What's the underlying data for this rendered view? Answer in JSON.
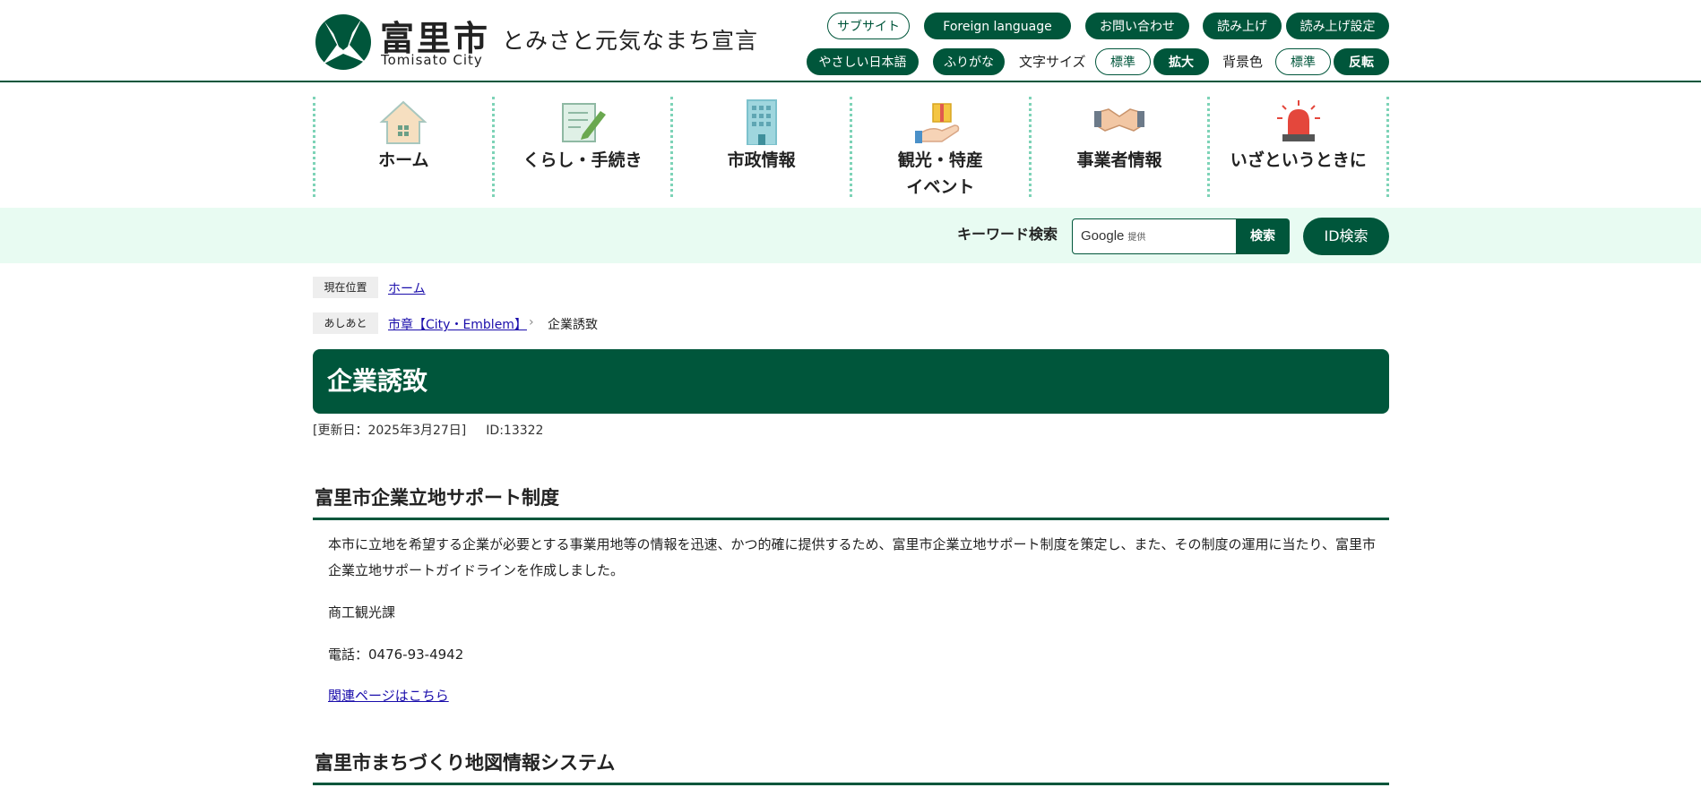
{
  "header": {
    "logo_jp": "富里市",
    "logo_en": "Tomisato City",
    "slogan": "とみさと元気なまち宣言",
    "sub_site": "サブサイト",
    "foreign_language": "Foreign language",
    "contact": "お問い合わせ",
    "read_aloud": "読み上げ",
    "read_aloud_settings": "読み上げ設定",
    "easy_japanese": "やさしい日本語",
    "furigana": "ふりがな",
    "font_size_label": "文字サイズ",
    "font_size_standard": "標準",
    "font_size_large": "拡大",
    "bg_color_label": "背景色",
    "bg_standard": "標準",
    "bg_invert": "反転"
  },
  "nav": {
    "items": [
      {
        "label": "ホーム",
        "icon": "house-icon"
      },
      {
        "label": "くらし・手続き",
        "icon": "document-pencil-icon"
      },
      {
        "label": "市政情報",
        "icon": "building-icon"
      },
      {
        "label": "観光・特産\nイベント",
        "icon": "gift-hand-icon"
      },
      {
        "label": "事業者情報",
        "icon": "handshake-icon"
      },
      {
        "label": "いざというときに",
        "icon": "alarm-light-icon"
      }
    ]
  },
  "search": {
    "keyword_label": "キーワード検索",
    "google_label": "Google",
    "google_provided": "提供",
    "search_button": "検索",
    "id_search_button": "ID検索"
  },
  "breadcrumbs": {
    "current_label": "現在位置",
    "home_link": "ホーム",
    "trail_label": "あしあと",
    "trail_link": "市章【City・Emblem】",
    "trail_sep": "›",
    "trail_current": "企業誘致"
  },
  "page": {
    "title": "企業誘致",
    "updated": "[更新日：2025年3月27日]",
    "id": "ID:13322"
  },
  "sections": [
    {
      "heading": "富里市企業立地サポート制度",
      "body": "本市に立地を希望する企業が必要とする事業用地等の情報を迅速、かつ的確に提供するため、富里市企業立地サポート制度を策定し、また、その制度の運用に当たり、富里市企業立地サポートガイドラインを作成しました。",
      "department": "商工観光課",
      "phone": "電話：0476-93-4942",
      "link": "関連ページはこちら"
    },
    {
      "heading": "富里市まちづくり地図情報システム"
    }
  ],
  "colors": {
    "brand_green": "#00563b",
    "nav_divider": "#7dd3b7",
    "search_band_bg": "#e8fbf2"
  }
}
